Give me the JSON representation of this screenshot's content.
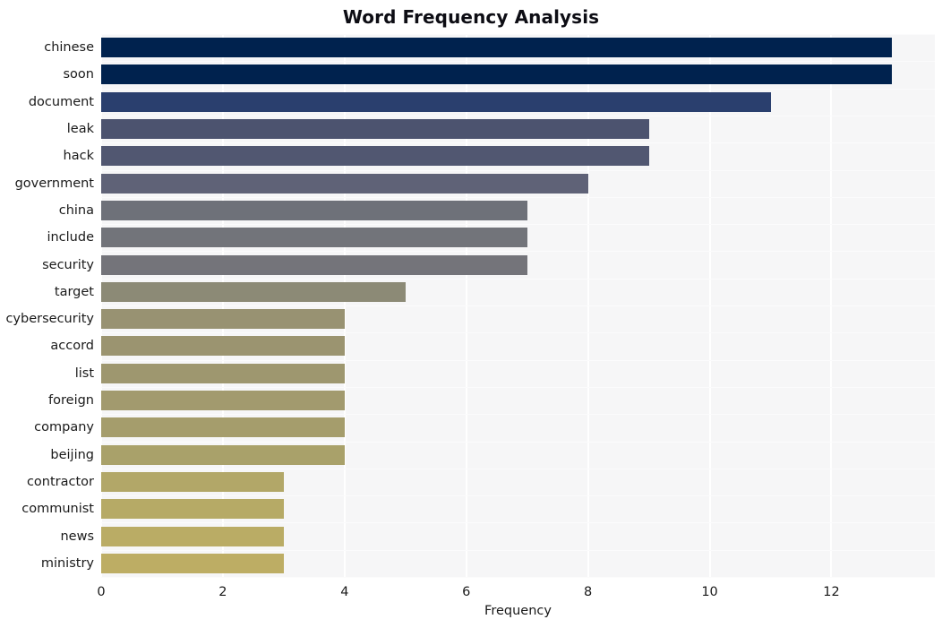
{
  "chart_data": {
    "type": "bar",
    "orientation": "horizontal",
    "title": "Word Frequency Analysis",
    "xlabel": "Frequency",
    "ylabel": "",
    "categories": [
      "chinese",
      "soon",
      "document",
      "leak",
      "hack",
      "government",
      "china",
      "include",
      "security",
      "target",
      "cybersecurity",
      "accord",
      "list",
      "foreign",
      "company",
      "beijing",
      "contractor",
      "communist",
      "news",
      "ministry"
    ],
    "values": [
      13,
      13,
      11,
      9,
      9,
      8,
      7,
      7,
      7,
      5,
      4,
      4,
      4,
      4,
      4,
      4,
      3,
      3,
      3,
      3
    ],
    "bar_colors": [
      "#00224e",
      "#00224e",
      "#2a3f6e",
      "#4c536f",
      "#515771",
      "#5f6277",
      "#6e7179",
      "#72747a",
      "#74747a",
      "#8c8a76",
      "#989272",
      "#9b9470",
      "#9e976f",
      "#a29a6e",
      "#a59d6c",
      "#a9a16a",
      "#b2a768",
      "#b6aa66",
      "#baac65",
      "#bdad64"
    ],
    "xlim": [
      0,
      13.7
    ],
    "xticks": [
      0,
      2,
      4,
      6,
      8,
      10,
      12
    ],
    "xtick_labels": [
      "0",
      "2",
      "4",
      "6",
      "8",
      "10",
      "12"
    ],
    "grid": true,
    "grid_color": "#ffffff",
    "plot_background": "#f6f6f7",
    "figure_background": "#ffffff",
    "legend": null
  }
}
